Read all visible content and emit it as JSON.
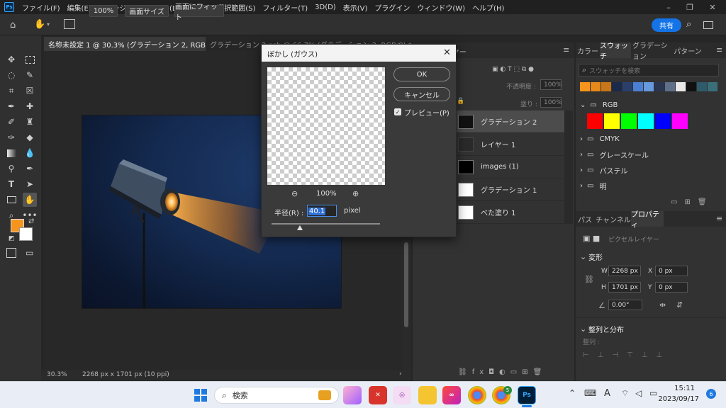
{
  "app": {
    "logo": "Ps"
  },
  "menu": [
    "ファイル(F)",
    "編集(E)",
    "イメージ(I)",
    "レイヤー(L)",
    "書式(Y)",
    "選択範囲(S)",
    "フィルター(T)",
    "3D(D)",
    "表示(V)",
    "プラグイン",
    "ウィンドウ(W)",
    "ヘルプ(H)"
  ],
  "options": {
    "zoom": "100%",
    "fit_screen": "画面サイズ",
    "fit_window": "画面にフィット",
    "share": "共有"
  },
  "doc_tabs": [
    "名称未設定 1 @ 30.3% (グラデーション 2, RGB/8) *",
    "グラデーション 2.psb @ 66.7% (グラデーション 2, RGB/8) *"
  ],
  "status": {
    "zoom": "30.3%",
    "size": "2268 px x 1701 px (10 ppi)"
  },
  "dialog": {
    "title": "ぼかし (ガウス)",
    "ok": "OK",
    "cancel": "キャンセル",
    "preview_label": "プレビュー(P)",
    "preview_checked": true,
    "zoom": "100%",
    "radius_label": "半径(R) :",
    "radius_value": "40.1",
    "radius_unit": "pixel",
    "radius_slider_fraction": 0.26
  },
  "layers_panel": {
    "tab": "レイヤー",
    "opacity_label": "不透明度 :",
    "opacity_value": "100%",
    "fill_label": "塗り :",
    "fill_value": "100%",
    "layers": [
      {
        "name": "グラデーション 2",
        "selected": true
      },
      {
        "name": "レイヤー 1",
        "selected": false
      },
      {
        "name": "images (1)",
        "selected": false
      },
      {
        "name": "グラデーション 1",
        "selected": false
      },
      {
        "name": "べた塗り 1",
        "selected": false
      }
    ]
  },
  "swatches_panel": {
    "tabs": [
      "カラー",
      "スウォッチ",
      "グラデーション",
      "パターン"
    ],
    "search_placeholder": "スウォッチを検索",
    "recent": [
      "#f7941d",
      "#e8891a",
      "#c8761a",
      "#1b2a4a",
      "#2a3f6a",
      "#4a7fd4",
      "#6699dd",
      "#2a3550",
      "#5f6f8a",
      "#e8e8e8",
      "#111111",
      "#2f5a6a",
      "#3a6f7a"
    ],
    "groups": [
      "RGB",
      "CMYK",
      "グレースケール",
      "パステル",
      "明"
    ],
    "rgb_colors": [
      "#ff0000",
      "#ffff00",
      "#00ff00",
      "#00ffff",
      "#0000ff",
      "#ff00ff"
    ]
  },
  "properties_panel": {
    "tabs": [
      "パス",
      "チャンネル",
      "プロパティ"
    ],
    "kind": "ピクセルレイヤー",
    "transform_label": "変形",
    "w_label": "W",
    "w_value": "2268 px",
    "h_label": "H",
    "h_value": "1701 px",
    "x_label": "X",
    "x_value": "0 px",
    "y_label": "Y",
    "y_value": "0 px",
    "angle": "0.00°",
    "align_label": "整列と分布",
    "align_sub": "整列 :"
  },
  "taskbar": {
    "search": "検索",
    "time": "15:11",
    "date": "2023/09/17",
    "notif_count": "6",
    "badge": "5",
    "ime": "A"
  }
}
